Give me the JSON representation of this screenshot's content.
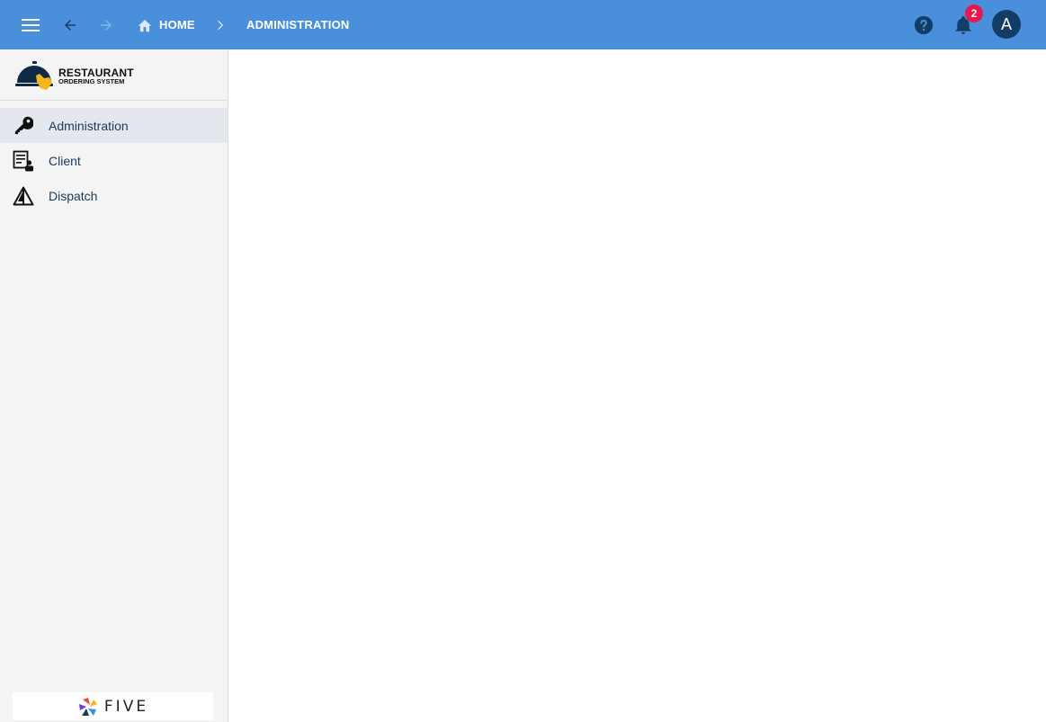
{
  "topbar": {
    "menu_icon": "hamburger-menu-icon",
    "back_icon": "arrow-left-icon",
    "forward_icon": "arrow-right-icon",
    "breadcrumb": [
      {
        "label": "HOME",
        "icon": "home-icon"
      },
      {
        "label": "ADMINISTRATION"
      }
    ],
    "help_icon": "help-circle-icon",
    "notification_icon": "bell-icon",
    "notification_count": "2",
    "avatar_initial": "A",
    "background_color": "#4a8fdb"
  },
  "sidebar": {
    "logo": {
      "line1": "RESTAURANT",
      "line2": "ORDERING SYSTEM"
    },
    "items": [
      {
        "label": "Administration",
        "icon": "key-icon",
        "active": true
      },
      {
        "label": "Client",
        "icon": "client-list-icon",
        "active": false
      },
      {
        "label": "Dispatch",
        "icon": "dispatch-triangle-icon",
        "active": false
      }
    ],
    "footer_logo": "FIVE"
  }
}
